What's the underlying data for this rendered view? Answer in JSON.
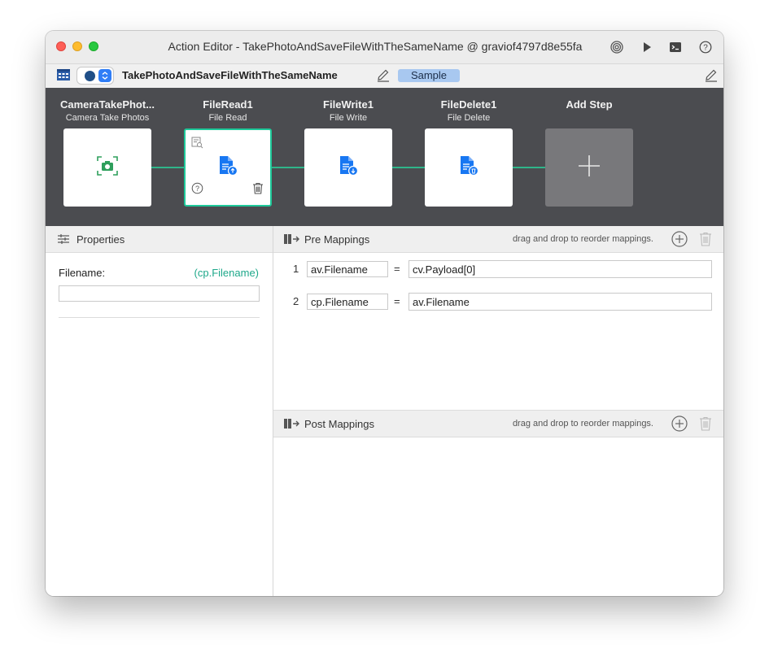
{
  "window": {
    "title": "Action Editor - TakePhotoAndSaveFileWithTheSameName @ graviof4797d8e55fa"
  },
  "toolbar": {
    "action_name": "TakePhotoAndSaveFileWithTheSameName",
    "badge": "Sample"
  },
  "steps": [
    {
      "title": "CameraTakePhot...",
      "subtitle": "Camera Take Photos",
      "icon": "camera-icon"
    },
    {
      "title": "FileRead1",
      "subtitle": "File Read",
      "icon": "file-read-icon",
      "selected": true
    },
    {
      "title": "FileWrite1",
      "subtitle": "File Write",
      "icon": "file-write-icon"
    },
    {
      "title": "FileDelete1",
      "subtitle": "File Delete",
      "icon": "file-delete-icon"
    }
  ],
  "add_step": {
    "title": "Add Step"
  },
  "properties": {
    "header": "Properties",
    "field_label": "Filename:",
    "field_mapping": "(cp.Filename)",
    "field_value": ""
  },
  "pre_mappings": {
    "header": "Pre Mappings",
    "hint": "drag and drop to reorder mappings.",
    "rows": [
      {
        "index": "1",
        "left": "av.Filename",
        "eq": "=",
        "right": "cv.Payload[0]"
      },
      {
        "index": "2",
        "left": "cp.Filename",
        "eq": "=",
        "right": "av.Filename"
      }
    ]
  },
  "post_mappings": {
    "header": "Post Mappings",
    "hint": "drag and drop to reorder mappings."
  },
  "colors": {
    "accent": "#1ec99a",
    "step_bar": "#4b4c50",
    "file_icon": "#1877f2",
    "camera_icon": "#2e9f5c"
  }
}
